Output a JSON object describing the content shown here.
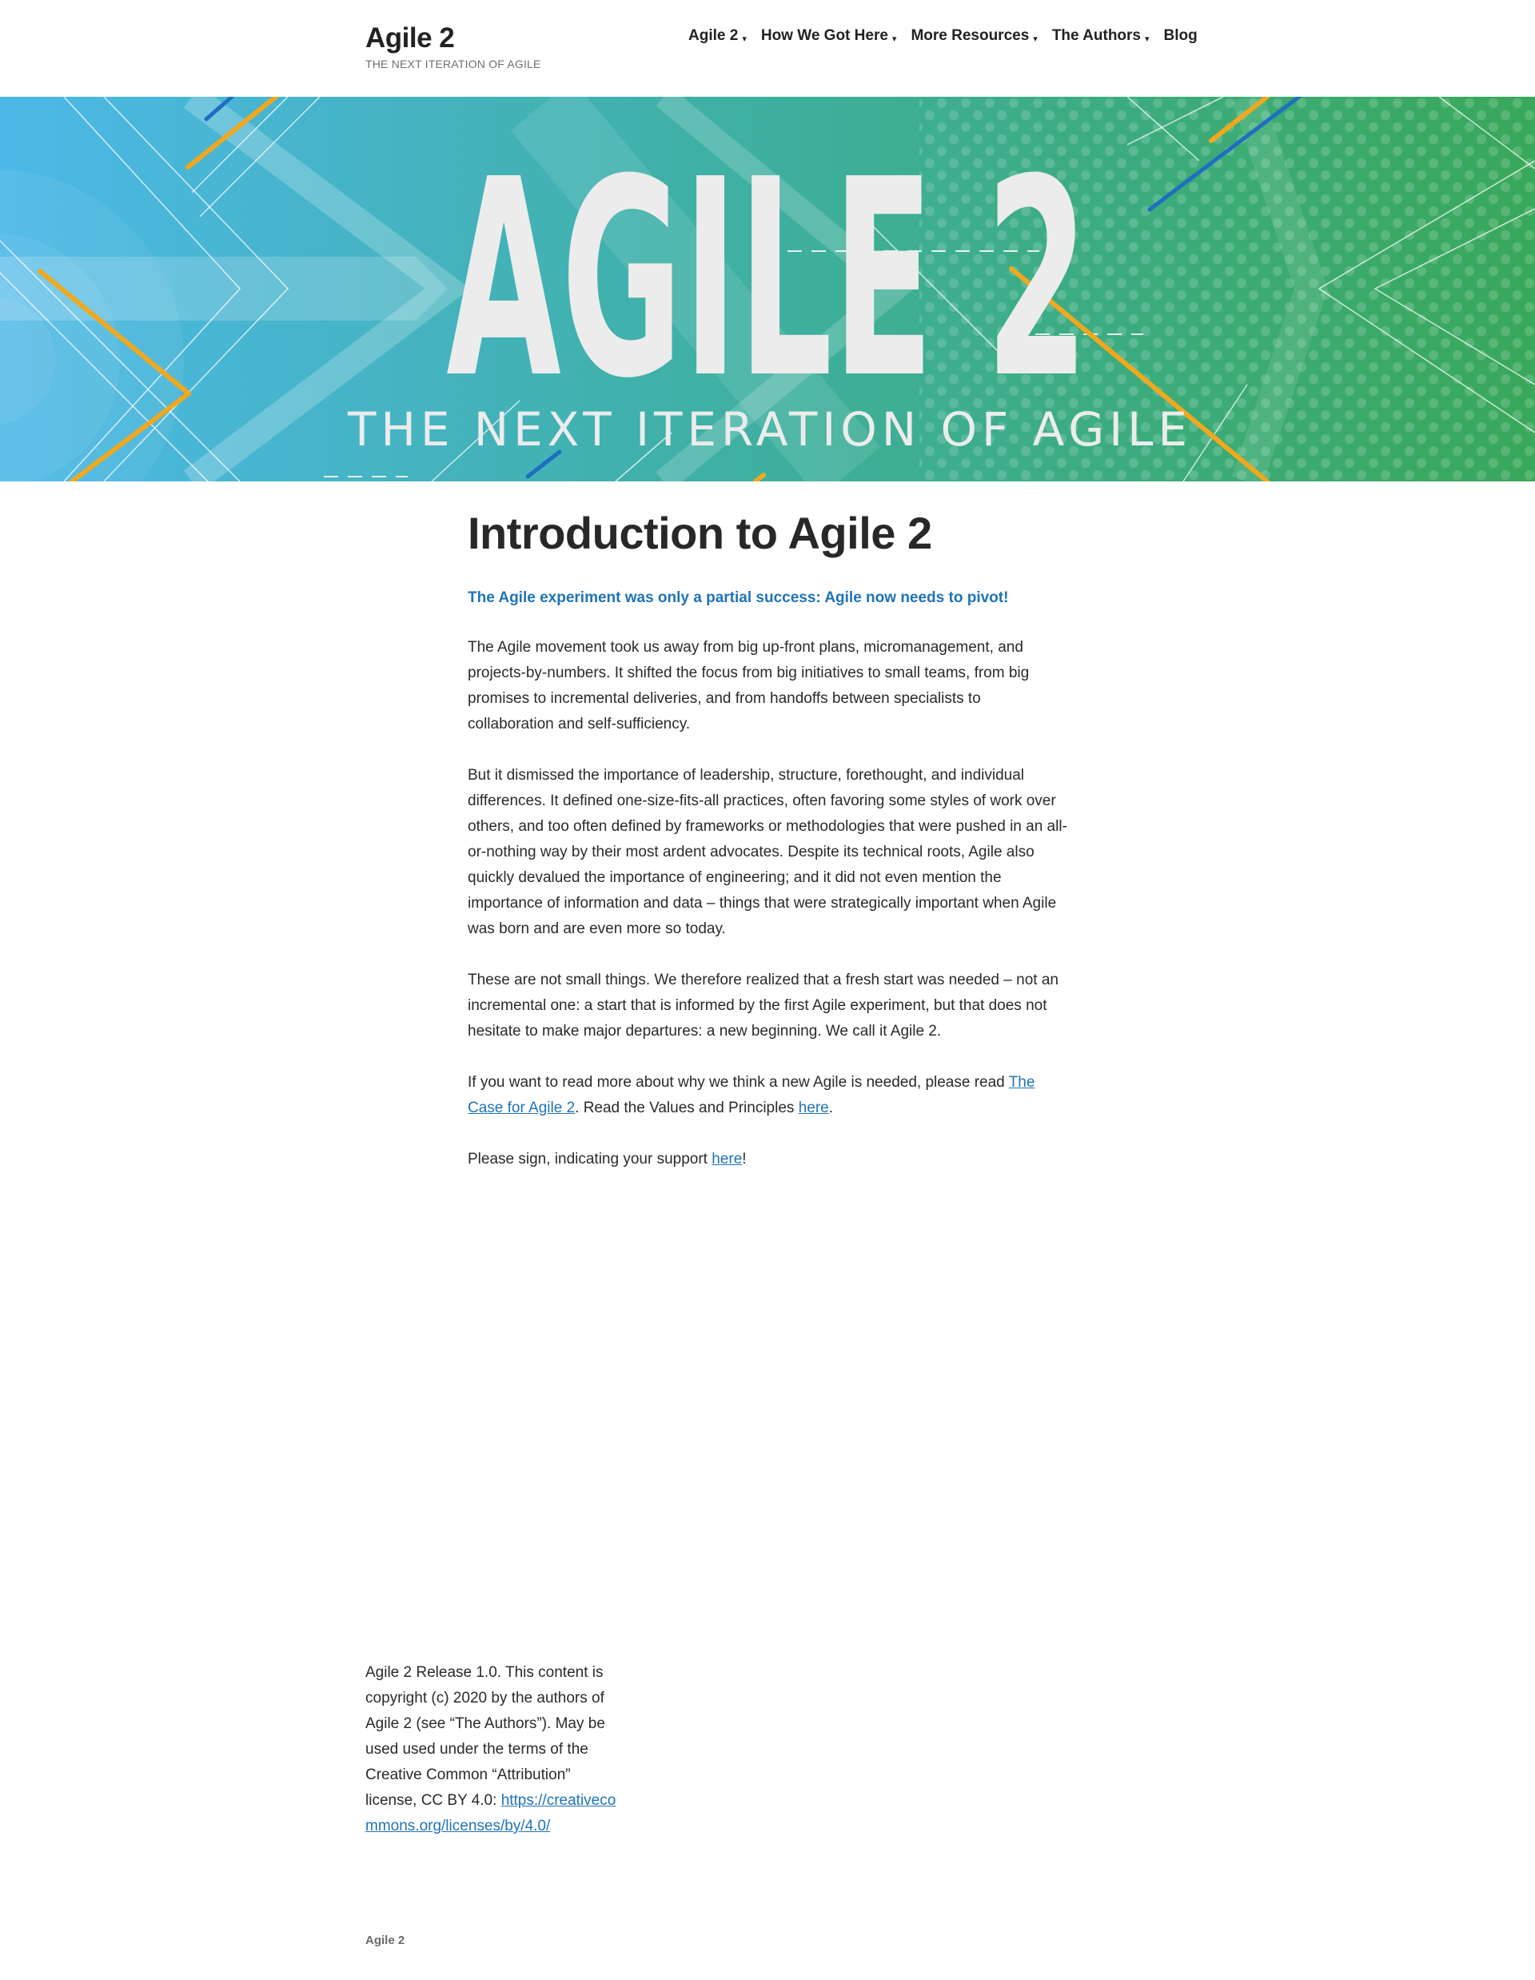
{
  "header": {
    "site_title": "Agile 2",
    "site_description": "THE NEXT ITERATION OF AGILE",
    "nav": [
      {
        "label": "Agile 2",
        "caret": "▾"
      },
      {
        "label": "How We Got Here",
        "caret": "▾"
      },
      {
        "label": "More Resources",
        "caret": "▾"
      },
      {
        "label": "The Authors",
        "caret": "▾"
      },
      {
        "label": "Blog",
        "caret": ""
      }
    ]
  },
  "hero": {
    "headline": "AGILE 2",
    "tagline": "THE NEXT ITERATION OF AGILE",
    "colors": {
      "left": "#4cb7e6",
      "right": "#3aa85c",
      "accent_orange": "#f2a81d",
      "accent_blue": "#1e6fc0",
      "text": "#ececec"
    }
  },
  "entry": {
    "title": "Introduction to Agile 2",
    "lead": "The Agile experiment was only a partial success: Agile now needs to pivot!",
    "p1": "The Agile movement took us away from big up-front plans, micromanagement, and projects-by-numbers. It shifted the focus from big initiatives to small teams, from big promises to incremental deliveries, and from handoffs between specialists to collaboration and self-sufficiency.",
    "p2": "But it dismissed the importance of leadership, structure, forethought, and individual differences. It defined one-size-fits-all practices, often favoring some styles of work over others, and too often defined by frameworks or methodologies that were pushed in an all-or-nothing way by their most ardent advocates. Despite its technical roots, Agile also quickly devalued the importance of engineering; and it did not even mention the importance of information and data – things that were strategically important when Agile was born and are even more so today.",
    "p3": "These are not small things. We therefore realized that a fresh start was needed – not an incremental one: a start that is informed by the first Agile experiment, but that does not hesitate to make major departures: a new beginning. We call it Agile 2.",
    "p4": {
      "before": "If you want to read more about why we think a new Agile is needed, please read ",
      "link1": "The Case for Agile 2",
      "middle": ". Read the Values and Principles ",
      "link2": "here",
      "after": "."
    },
    "p5": {
      "before": "Please sign, indicating your support ",
      "link": "here",
      "after": "!"
    }
  },
  "footer": {
    "license_text": "Agile 2 Release 1.0. This content is copyright (c) 2020 by the authors of Agile 2 (see “The Authors”). May be used used under the terms of the Creative Common “Attribution” license, CC BY 4.0: ",
    "license_link": "https://creativecommons.org/licenses/by/4.0/",
    "site_info": "Agile 2"
  }
}
